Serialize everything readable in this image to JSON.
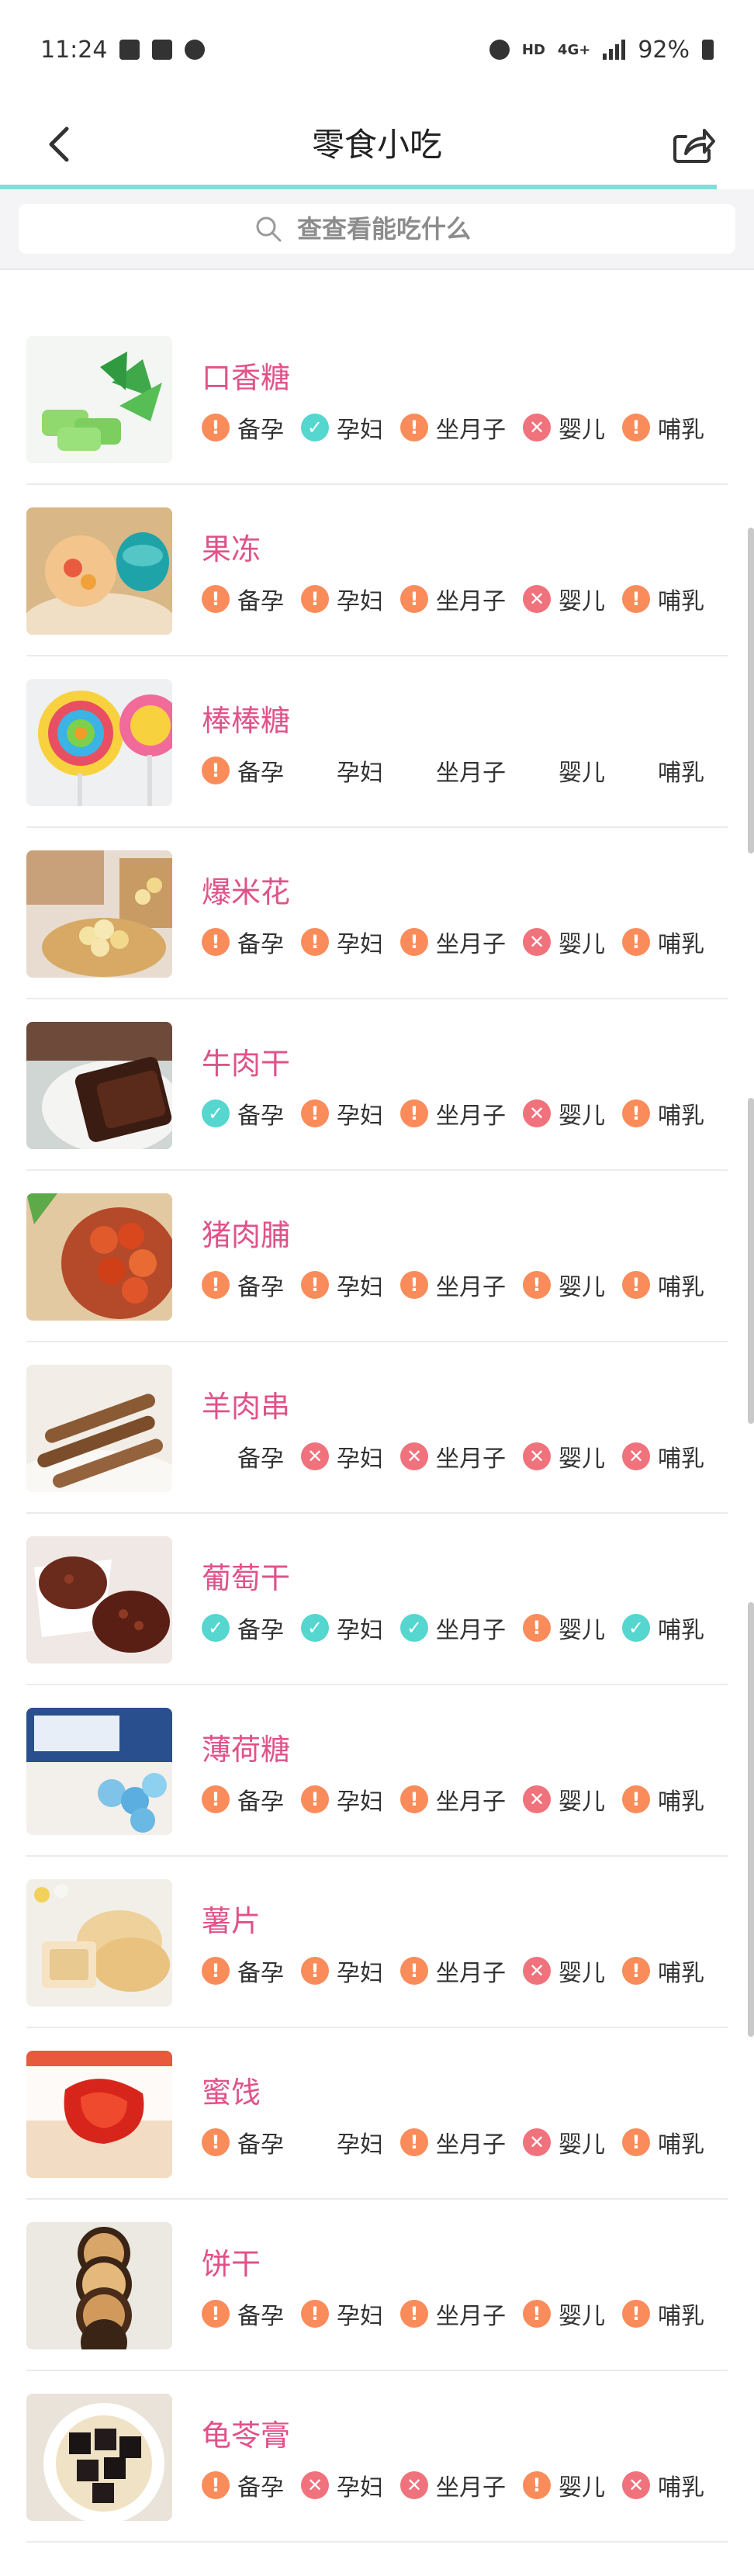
{
  "status": {
    "time": "11:24",
    "network": "HD",
    "net_type": "4G+",
    "battery": "92%"
  },
  "header": {
    "title": "零食小吃"
  },
  "search": {
    "placeholder": "查查看能吃什么"
  },
  "colors": {
    "accent": "#e0528a",
    "warn": "#f98c5a",
    "ok": "#55d6cf",
    "no": "#f0727c",
    "unknown": "#a995f0"
  },
  "groups": [
    "备孕",
    "孕妇",
    "坐月子",
    "婴儿",
    "哺乳"
  ],
  "items": [
    {
      "name": "口香糖",
      "status": [
        "warn",
        "ok",
        "warn",
        "no",
        "warn"
      ]
    },
    {
      "name": "果冻",
      "status": [
        "warn",
        "warn",
        "warn",
        "no",
        "warn"
      ]
    },
    {
      "name": "棒棒糖",
      "status": [
        "warn",
        "unknown",
        "unknown",
        "unknown",
        "unknown"
      ]
    },
    {
      "name": "爆米花",
      "status": [
        "warn",
        "warn",
        "warn",
        "no",
        "warn"
      ]
    },
    {
      "name": "牛肉干",
      "status": [
        "ok",
        "warn",
        "warn",
        "no",
        "warn"
      ]
    },
    {
      "name": "猪肉脯",
      "status": [
        "warn",
        "warn",
        "warn",
        "warn",
        "warn"
      ]
    },
    {
      "name": "羊肉串",
      "status": [
        "unknown",
        "no",
        "no",
        "no",
        "no"
      ]
    },
    {
      "name": "葡萄干",
      "status": [
        "ok",
        "ok",
        "ok",
        "warn",
        "ok"
      ]
    },
    {
      "name": "薄荷糖",
      "status": [
        "warn",
        "warn",
        "warn",
        "no",
        "warn"
      ]
    },
    {
      "name": "薯片",
      "status": [
        "warn",
        "warn",
        "warn",
        "no",
        "warn"
      ]
    },
    {
      "name": "蜜饯",
      "status": [
        "warn",
        "unknown",
        "warn",
        "no",
        "warn"
      ]
    },
    {
      "name": "饼干",
      "status": [
        "warn",
        "warn",
        "warn",
        "warn",
        "warn"
      ]
    },
    {
      "name": "龟苓膏",
      "status": [
        "warn",
        "no",
        "no",
        "warn",
        "no"
      ]
    }
  ]
}
